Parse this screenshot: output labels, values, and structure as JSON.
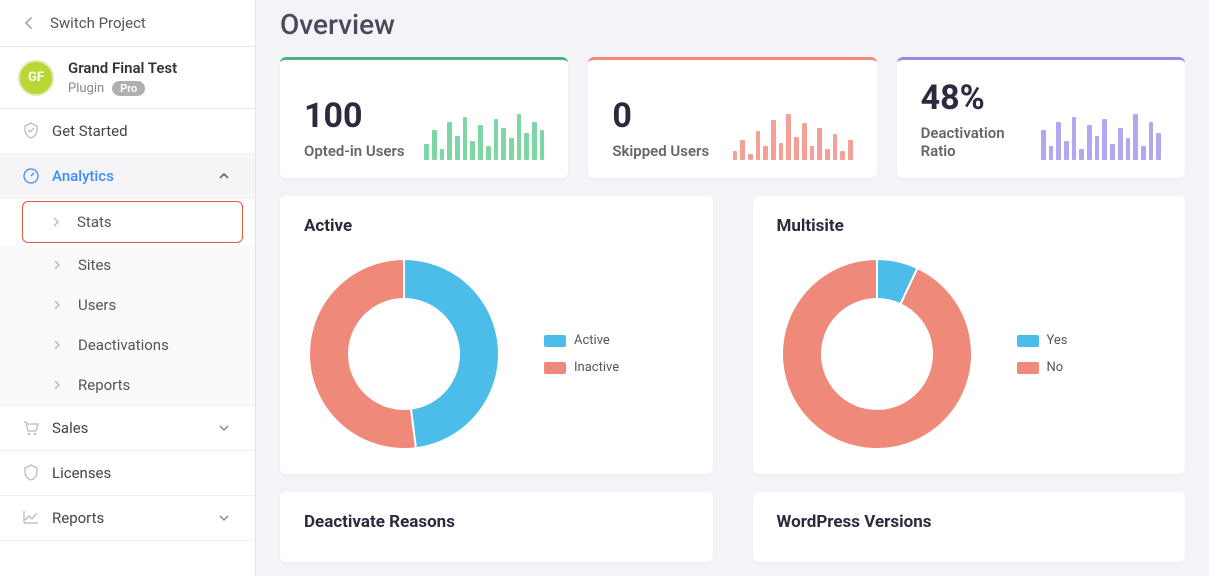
{
  "sidebar": {
    "switch_label": "Switch Project",
    "project": {
      "avatar": "GF",
      "title": "Grand Final Test",
      "type": "Plugin",
      "badge": "Pro"
    },
    "items": {
      "get_started": "Get Started",
      "analytics": "Analytics",
      "sales": "Sales",
      "licenses": "Licenses",
      "reports": "Reports"
    },
    "analytics_children": {
      "stats": "Stats",
      "sites": "Sites",
      "users": "Users",
      "deactivations": "Deactivations",
      "reports": "Reports"
    }
  },
  "page": {
    "title": "Overview"
  },
  "kpis": {
    "opted": {
      "value": "100",
      "label": "Opted-in Users",
      "spark": [
        12,
        22,
        8,
        28,
        18,
        32,
        14,
        26,
        10,
        30,
        24,
        16,
        34,
        20,
        28,
        22
      ]
    },
    "skipped": {
      "value": "0",
      "label": "Skipped Users",
      "spark": [
        6,
        14,
        4,
        20,
        10,
        28,
        12,
        32,
        16,
        26,
        10,
        22,
        8,
        18,
        6,
        14
      ]
    },
    "deact": {
      "value": "48%",
      "label": "Deactivation Ratio",
      "spark": [
        22,
        10,
        28,
        14,
        32,
        8,
        26,
        18,
        30,
        12,
        24,
        16,
        34,
        10,
        28,
        20
      ]
    }
  },
  "charts": {
    "active": {
      "title": "Active",
      "legend": [
        {
          "label": "Active",
          "color": "#4bbde8"
        },
        {
          "label": "Inactive",
          "color": "#ef8a7b"
        }
      ]
    },
    "multisite": {
      "title": "Multisite",
      "legend": [
        {
          "label": "Yes",
          "color": "#4bbde8"
        },
        {
          "label": "No",
          "color": "#ef8a7b"
        }
      ]
    }
  },
  "sections": {
    "deact_reasons": "Deactivate Reasons",
    "wp_versions": "WordPress Versions"
  },
  "chart_data": [
    {
      "type": "pie",
      "title": "Active",
      "series": [
        {
          "name": "Active",
          "value": 48,
          "color": "#4bbde8"
        },
        {
          "name": "Inactive",
          "value": 52,
          "color": "#ef8a7b"
        }
      ]
    },
    {
      "type": "pie",
      "title": "Multisite",
      "series": [
        {
          "name": "Yes",
          "value": 7,
          "color": "#4bbde8"
        },
        {
          "name": "No",
          "value": 93,
          "color": "#ef8a7b"
        }
      ]
    }
  ],
  "colors": {
    "blue": "#4bbde8",
    "coral": "#ef8a7b",
    "green": "#7ed6a5",
    "purple": "#b3a7f0"
  }
}
